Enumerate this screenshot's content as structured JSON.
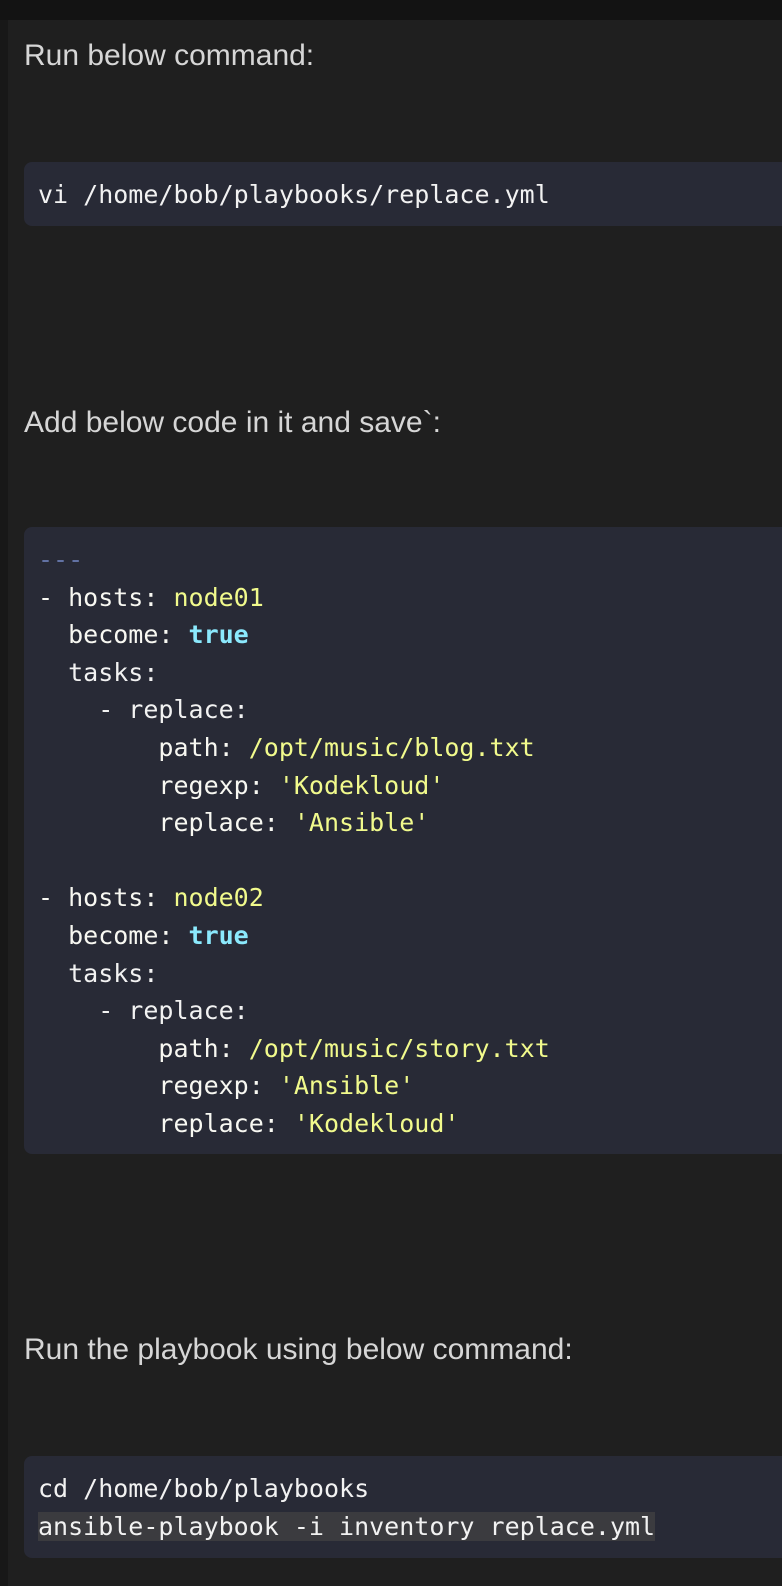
{
  "paragraphs": {
    "step1": "Run below command:",
    "step2": "Add below code in it and save`:",
    "step3": "Run the playbook using below command:"
  },
  "code_blocks": {
    "open_file": {
      "lines": [
        "vi /home/bob/playbooks/replace.yml"
      ]
    },
    "playbook": {
      "doc_separator": "---",
      "plays": [
        {
          "hosts_key": "- hosts: ",
          "hosts_value": "node01",
          "become_key": "  become: ",
          "become_value": "true",
          "tasks_key": "  tasks:",
          "task_dash": "    - replace:",
          "path_key": "        path: ",
          "path_value": "/opt/music/blog.txt",
          "regexp_key": "        regexp: ",
          "regexp_value": "'Kodekloud'",
          "replace_key": "        replace: ",
          "replace_value": "'Ansible'"
        },
        {
          "hosts_key": "- hosts: ",
          "hosts_value": "node02",
          "become_key": "  become: ",
          "become_value": "true",
          "tasks_key": "  tasks:",
          "task_dash": "    - replace:",
          "path_key": "        path: ",
          "path_value": "/opt/music/story.txt",
          "regexp_key": "        regexp: ",
          "regexp_value": "'Ansible'",
          "replace_key": "        replace: ",
          "replace_value": "'Kodekloud'"
        }
      ]
    },
    "run_playbook": {
      "lines": [
        "cd /home/bob/playbooks",
        "ansible-playbook -i inventory replace.yml"
      ]
    }
  }
}
